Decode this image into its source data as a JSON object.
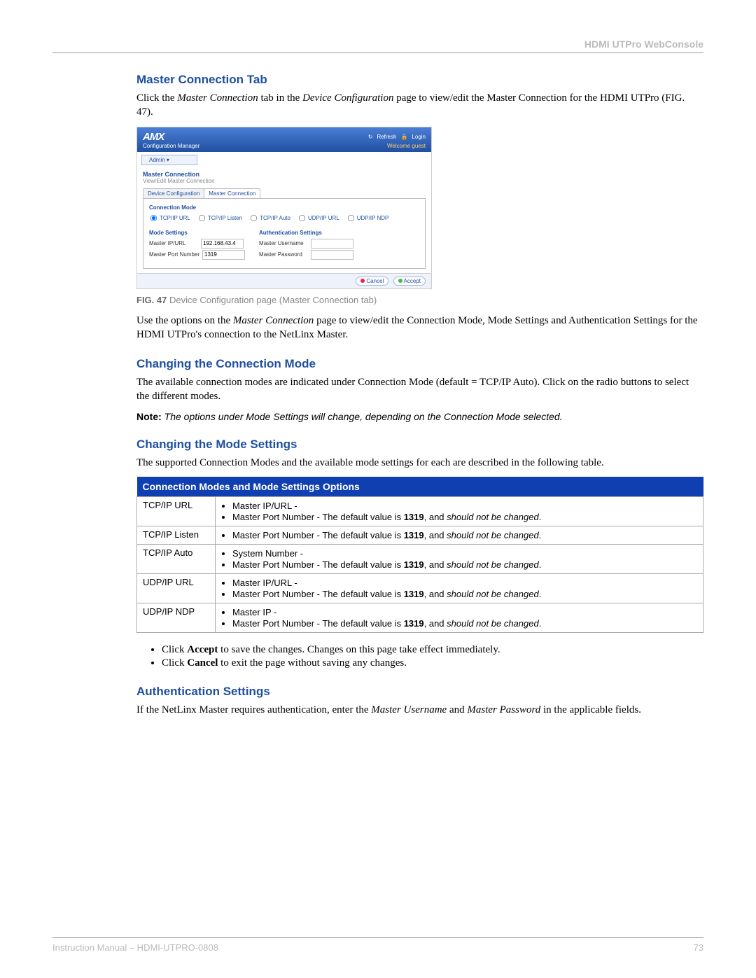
{
  "header": {
    "right": "HDMI UTPro WebConsole"
  },
  "sections": {
    "s1": {
      "title": "Master Connection Tab",
      "p1a": "Click the ",
      "p1b": "Master Connection",
      "p1c": " tab in the ",
      "p1d": "Device Configuration",
      "p1e": " page to view/edit the Master Connection for the HDMI UTPro (FIG. 47)."
    },
    "fig": {
      "logo": "AMX",
      "logoSub": "Configuration Manager",
      "refresh": "Refresh",
      "login": "Login",
      "welcome": "Welcome guest",
      "admin": "Admin ▾",
      "hTitle": "Master Connection",
      "hSub": "View/Edit Master Connection",
      "tab1": "Device Configuration",
      "tab2": "Master Connection",
      "connMode": "Connection Mode",
      "radios": [
        "TCP/IP URL",
        "TCP/IP Listen",
        "TCP/IP Auto",
        "UDP/IP URL",
        "UDP/IP NDP"
      ],
      "modeSettings": "Mode Settings",
      "authSettings": "Authentication Settings",
      "f1l": "Master IP/URL",
      "f1v": "192.168.43.4",
      "f2l": "Master Port Number",
      "f2v": "1319",
      "f3l": "Master Username",
      "f4l": "Master Password",
      "cancel": "Cancel",
      "accept": "Accept",
      "captionBold": "FIG. 47",
      "caption": " Device Configuration page (Master Connection tab)"
    },
    "p_after_fig_a": "Use the options on the ",
    "p_after_fig_b": "Master Connection",
    "p_after_fig_c": " page to view/edit the Connection Mode, Mode Settings and Authentication Settings for the HDMI UTPro's connection to the NetLinx Master.",
    "s2": {
      "title": "Changing the Connection Mode",
      "p1": "The available connection modes are indicated under Connection Mode (default = TCP/IP Auto). Click on the radio buttons to select the different modes.",
      "noteLabel": "Note:",
      "noteBody": " The options under Mode Settings will change, depending on the Connection Mode selected."
    },
    "s3": {
      "title": "Changing the Mode Settings",
      "p1": "The supported Connection Modes and the available mode settings for each are described in the following table."
    },
    "table": {
      "header": "Connection Modes and Mode Settings Options",
      "rows": [
        {
          "mode": "TCP/IP URL",
          "items": [
            "Master IP/URL -",
            "Master Port Number - The default value is <b>1319</b>, and <i>should not be changed</i>."
          ]
        },
        {
          "mode": "TCP/IP Listen",
          "items": [
            "Master Port Number - The default value is <b>1319</b>, and <i>should not be changed</i>."
          ]
        },
        {
          "mode": "TCP/IP Auto",
          "items": [
            "System Number -",
            "Master Port Number - The default value is <b>1319</b>, and <i>should not be changed</i>."
          ]
        },
        {
          "mode": "UDP/IP URL",
          "items": [
            "Master IP/URL -",
            "Master Port Number - The default value is <b>1319</b>, and <i>should not be changed</i>."
          ]
        },
        {
          "mode": "UDP/IP NDP",
          "items": [
            "Master IP -",
            "Master Port Number - The default value is <b>1319</b>, and <i>should not be changed</i>."
          ]
        }
      ]
    },
    "accept": [
      "Click <b>Accept</b> to save the changes. Changes on this page take effect immediately.",
      "Click <b>Cancel</b> to exit the page without saving any changes."
    ],
    "s4": {
      "title": "Authentication Settings",
      "p_a": "If the NetLinx Master requires authentication, enter the ",
      "p_b": "Master Username",
      "p_c": " and ",
      "p_d": "Master Password",
      "p_e": " in the applicable fields."
    }
  },
  "footer": {
    "left": "Instruction Manual – HDMI-UTPRO-0808",
    "right": "73"
  }
}
